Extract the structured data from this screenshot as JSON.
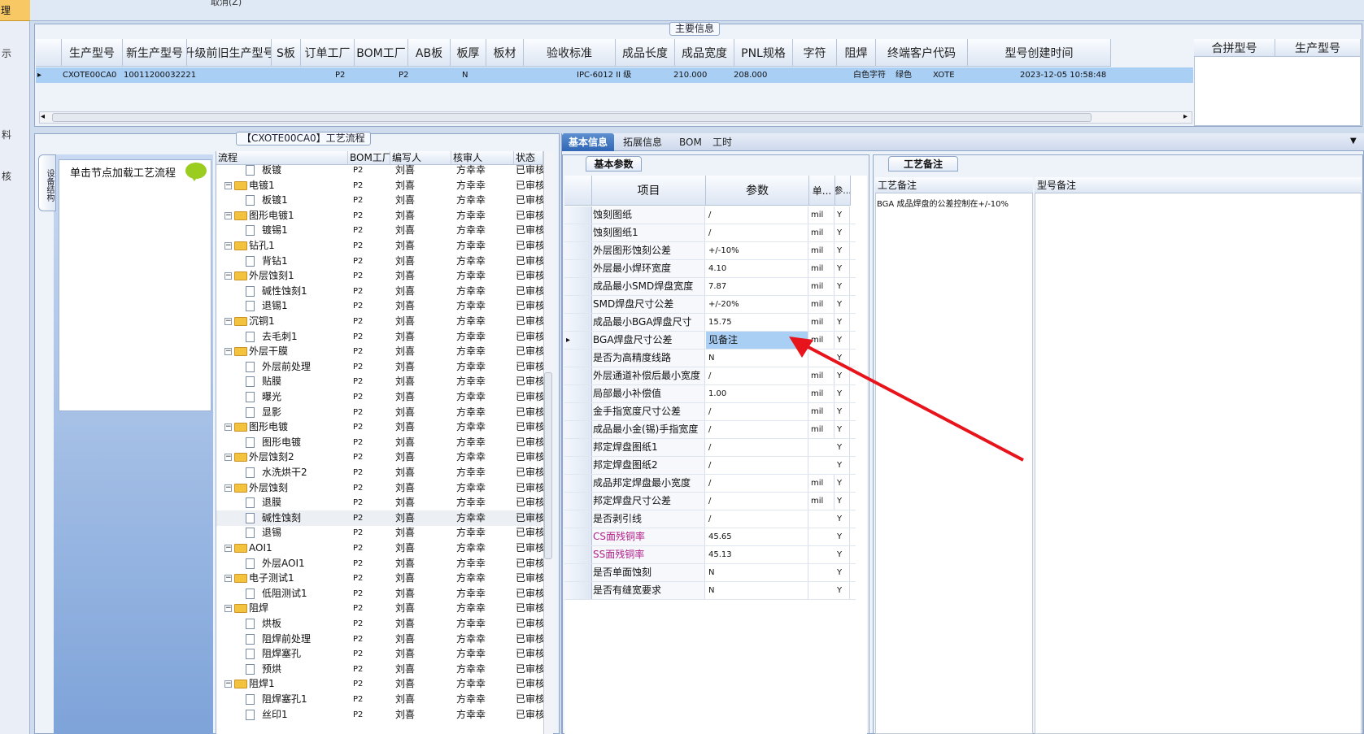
{
  "nav": {
    "selected": "理",
    "items": [
      "示",
      "料",
      "核"
    ]
  },
  "toolbar": {
    "cancel": "取消(Z)"
  },
  "main": {
    "title": "主要信息",
    "columns": [
      "生产型号",
      "新生产型号",
      "升级前旧生产型号",
      "S板",
      "订单工厂",
      "BOM工厂",
      "AB板",
      "板厚",
      "板材",
      "验收标准",
      "成品长度",
      "成品宽度",
      "PNL规格",
      "字符",
      "阻焊",
      "终端客户代码",
      "型号创建时间"
    ],
    "row": {
      "prod": "CXOTE00CA0",
      "new": "10011200032221",
      "old": "",
      "s": "",
      "order_factory": "P2",
      "bom_factory": "P2",
      "ab": "N",
      "thick": "",
      "material": "",
      "std": "IPC-6012 II 级",
      "len": "210.000",
      "wid": "208.000",
      "pnl": "",
      "char": "白色字符",
      "mask": "绿色",
      "cust": "XOTE",
      "created": "2023-12-05 10:58:48"
    },
    "side_columns": [
      "合拼型号",
      "生产型号"
    ]
  },
  "process": {
    "title": "【CXOTE00CA0】工艺流程",
    "side_tab": "设备结构",
    "hint": "单击节点加载工艺流程",
    "columns": [
      "流程",
      "BOM工厂",
      "编写人",
      "核审人",
      "状态"
    ],
    "rows": [
      {
        "name": "板镀",
        "lvl": 2,
        "factory": "P2",
        "writer": "刘喜",
        "reviewer": "方幸幸",
        "status": "已审核"
      },
      {
        "name": "电镀1",
        "lvl": 1,
        "factory": "P2",
        "writer": "刘喜",
        "reviewer": "方幸幸",
        "status": "已审核"
      },
      {
        "name": "板镀1",
        "lvl": 2,
        "factory": "P2",
        "writer": "刘喜",
        "reviewer": "方幸幸",
        "status": "已审核"
      },
      {
        "name": "图形电镀1",
        "lvl": 1,
        "factory": "P2",
        "writer": "刘喜",
        "reviewer": "方幸幸",
        "status": "已审核"
      },
      {
        "name": "镀锡1",
        "lvl": 2,
        "factory": "P2",
        "writer": "刘喜",
        "reviewer": "方幸幸",
        "status": "已审核"
      },
      {
        "name": "钻孔1",
        "lvl": 1,
        "factory": "P2",
        "writer": "刘喜",
        "reviewer": "方幸幸",
        "status": "已审核"
      },
      {
        "name": "背钻1",
        "lvl": 2,
        "factory": "P2",
        "writer": "刘喜",
        "reviewer": "方幸幸",
        "status": "已审核"
      },
      {
        "name": "外层蚀刻1",
        "lvl": 1,
        "factory": "P2",
        "writer": "刘喜",
        "reviewer": "方幸幸",
        "status": "已审核"
      },
      {
        "name": "碱性蚀刻1",
        "lvl": 2,
        "factory": "P2",
        "writer": "刘喜",
        "reviewer": "方幸幸",
        "status": "已审核"
      },
      {
        "name": "退锡1",
        "lvl": 2,
        "factory": "P2",
        "writer": "刘喜",
        "reviewer": "方幸幸",
        "status": "已审核"
      },
      {
        "name": "沉铜1",
        "lvl": 1,
        "factory": "P2",
        "writer": "刘喜",
        "reviewer": "方幸幸",
        "status": "已审核"
      },
      {
        "name": "去毛刺1",
        "lvl": 2,
        "factory": "P2",
        "writer": "刘喜",
        "reviewer": "方幸幸",
        "status": "已审核"
      },
      {
        "name": "外层干膜",
        "lvl": 1,
        "factory": "P2",
        "writer": "刘喜",
        "reviewer": "方幸幸",
        "status": "已审核"
      },
      {
        "name": "外层前处理",
        "lvl": 2,
        "factory": "P2",
        "writer": "刘喜",
        "reviewer": "方幸幸",
        "status": "已审核"
      },
      {
        "name": "贴膜",
        "lvl": 2,
        "factory": "P2",
        "writer": "刘喜",
        "reviewer": "方幸幸",
        "status": "已审核"
      },
      {
        "name": "曝光",
        "lvl": 2,
        "factory": "P2",
        "writer": "刘喜",
        "reviewer": "方幸幸",
        "status": "已审核"
      },
      {
        "name": "显影",
        "lvl": 2,
        "factory": "P2",
        "writer": "刘喜",
        "reviewer": "方幸幸",
        "status": "已审核"
      },
      {
        "name": "图形电镀",
        "lvl": 1,
        "factory": "P2",
        "writer": "刘喜",
        "reviewer": "方幸幸",
        "status": "已审核"
      },
      {
        "name": "图形电镀",
        "lvl": 2,
        "factory": "P2",
        "writer": "刘喜",
        "reviewer": "方幸幸",
        "status": "已审核"
      },
      {
        "name": "外层蚀刻2",
        "lvl": 1,
        "factory": "P2",
        "writer": "刘喜",
        "reviewer": "方幸幸",
        "status": "已审核"
      },
      {
        "name": "水洗烘干2",
        "lvl": 2,
        "factory": "P2",
        "writer": "刘喜",
        "reviewer": "方幸幸",
        "status": "已审核"
      },
      {
        "name": "外层蚀刻",
        "lvl": 1,
        "factory": "P2",
        "writer": "刘喜",
        "reviewer": "方幸幸",
        "status": "已审核"
      },
      {
        "name": "退膜",
        "lvl": 2,
        "factory": "P2",
        "writer": "刘喜",
        "reviewer": "方幸幸",
        "status": "已审核"
      },
      {
        "name": "碱性蚀刻",
        "lvl": 2,
        "factory": "P2",
        "writer": "刘喜",
        "reviewer": "方幸幸",
        "status": "已审核"
      },
      {
        "name": "退锡",
        "lvl": 2,
        "factory": "P2",
        "writer": "刘喜",
        "reviewer": "方幸幸",
        "status": "已审核"
      },
      {
        "name": "AOI1",
        "lvl": 1,
        "factory": "P2",
        "writer": "刘喜",
        "reviewer": "方幸幸",
        "status": "已审核"
      },
      {
        "name": "外层AOI1",
        "lvl": 2,
        "factory": "P2",
        "writer": "刘喜",
        "reviewer": "方幸幸",
        "status": "已审核"
      },
      {
        "name": "电子测试1",
        "lvl": 1,
        "factory": "P2",
        "writer": "刘喜",
        "reviewer": "方幸幸",
        "status": "已审核"
      },
      {
        "name": "低阻测试1",
        "lvl": 2,
        "factory": "P2",
        "writer": "刘喜",
        "reviewer": "方幸幸",
        "status": "已审核"
      },
      {
        "name": "阻焊",
        "lvl": 1,
        "factory": "P2",
        "writer": "刘喜",
        "reviewer": "方幸幸",
        "status": "已审核"
      },
      {
        "name": "烘板",
        "lvl": 2,
        "factory": "P2",
        "writer": "刘喜",
        "reviewer": "方幸幸",
        "status": "已审核"
      },
      {
        "name": "阻焊前处理",
        "lvl": 2,
        "factory": "P2",
        "writer": "刘喜",
        "reviewer": "方幸幸",
        "status": "已审核"
      },
      {
        "name": "阻焊塞孔",
        "lvl": 2,
        "factory": "P2",
        "writer": "刘喜",
        "reviewer": "方幸幸",
        "status": "已审核"
      },
      {
        "name": "预烘",
        "lvl": 2,
        "factory": "P2",
        "writer": "刘喜",
        "reviewer": "方幸幸",
        "status": "已审核"
      },
      {
        "name": "阻焊1",
        "lvl": 1,
        "factory": "P2",
        "writer": "刘喜",
        "reviewer": "方幸幸",
        "status": "已审核"
      },
      {
        "name": "阻焊塞孔1",
        "lvl": 2,
        "factory": "P2",
        "writer": "刘喜",
        "reviewer": "方幸幸",
        "status": "已审核"
      },
      {
        "name": "丝印1",
        "lvl": 2,
        "factory": "P2",
        "writer": "刘喜",
        "reviewer": "方幸幸",
        "status": "已审核"
      }
    ]
  },
  "tabs": [
    "基本信息",
    "拓展信息",
    "BOM",
    "工时"
  ],
  "basic": {
    "title": "基本参数",
    "columns": [
      "项目",
      "参数",
      "单...",
      "参..."
    ],
    "rows": [
      {
        "name": "蚀刻图纸",
        "value": "/",
        "unit": "mil",
        "flag": "Y"
      },
      {
        "name": "蚀刻图纸1",
        "value": "/",
        "unit": "mil",
        "flag": "Y"
      },
      {
        "name": "外层图形蚀刻公差",
        "value": "+/-10%",
        "unit": "mil",
        "flag": "Y"
      },
      {
        "name": "外层最小焊环宽度",
        "value": "4.10",
        "unit": "mil",
        "flag": "Y"
      },
      {
        "name": "成品最小SMD焊盘宽度",
        "value": "7.87",
        "unit": "mil",
        "flag": "Y"
      },
      {
        "name": "SMD焊盘尺寸公差",
        "value": "+/-20%",
        "unit": "mil",
        "flag": "Y"
      },
      {
        "name": "成品最小BGA焊盘尺寸",
        "value": "15.75",
        "unit": "mil",
        "flag": "Y"
      },
      {
        "name": "BGA焊盘尺寸公差",
        "value": "见备注",
        "unit": "mil",
        "flag": "Y"
      },
      {
        "name": "是否为高精度线路",
        "value": "N",
        "unit": "",
        "flag": "Y"
      },
      {
        "name": "外层通道补偿后最小宽度",
        "value": "/",
        "unit": "mil",
        "flag": "Y"
      },
      {
        "name": "局部最小补偿值",
        "value": "1.00",
        "unit": "mil",
        "flag": "Y"
      },
      {
        "name": "金手指宽度尺寸公差",
        "value": "/",
        "unit": "mil",
        "flag": "Y"
      },
      {
        "name": "成品最小金(锡)手指宽度",
        "value": "/",
        "unit": "mil",
        "flag": "Y"
      },
      {
        "name": "邦定焊盘图纸1",
        "value": "/",
        "unit": "",
        "flag": "Y"
      },
      {
        "name": "邦定焊盘图纸2",
        "value": "/",
        "unit": "",
        "flag": "Y"
      },
      {
        "name": "成品邦定焊盘最小宽度",
        "value": "/",
        "unit": "mil",
        "flag": "Y"
      },
      {
        "name": "邦定焊盘尺寸公差",
        "value": "/",
        "unit": "mil",
        "flag": "Y"
      },
      {
        "name": "是否剥引线",
        "value": "/",
        "unit": "",
        "flag": "Y"
      },
      {
        "name": "CS面残铜率",
        "value": "45.65",
        "unit": "",
        "flag": "Y",
        "pink": true
      },
      {
        "name": "SS面残铜率",
        "value": "45.13",
        "unit": "",
        "flag": "Y",
        "pink": true
      },
      {
        "name": "是否单面蚀刻",
        "value": "N",
        "unit": "",
        "flag": "Y"
      },
      {
        "name": "是否有缝宽要求",
        "value": "N",
        "unit": "",
        "flag": "Y"
      }
    ]
  },
  "notes": {
    "title": "工艺备注",
    "col1": "工艺备注",
    "col2": "型号备注",
    "text": "BGA 成品焊盘的公差控制在+/-10%"
  },
  "colors": {
    "accent": "#2f66b5",
    "selection": "#a9cff5",
    "arrow": "#e8141b",
    "pink": "#b0208a"
  }
}
